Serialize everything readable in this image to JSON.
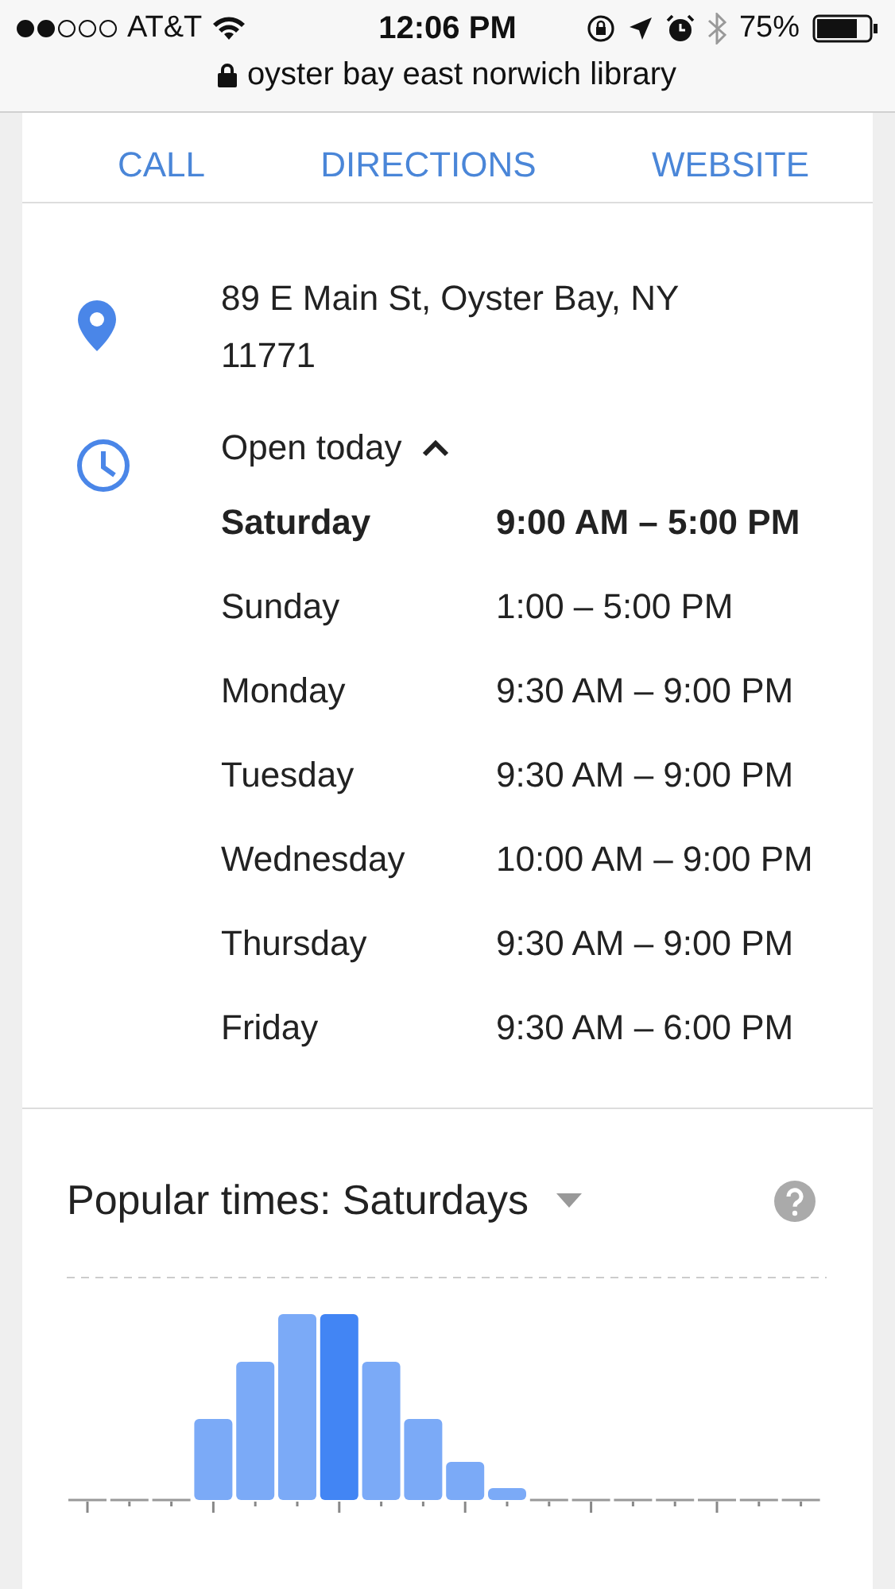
{
  "status_bar": {
    "carrier": "AT&T",
    "time": "12:06 PM",
    "battery": "75%"
  },
  "url_bar": {
    "title": "oyster bay east norwich library"
  },
  "actions": [
    {
      "label": "CALL"
    },
    {
      "label": "DIRECTIONS"
    },
    {
      "label": "WEBSITE"
    }
  ],
  "address": {
    "lines": [
      "89 E Main St, Oyster Bay, NY",
      "11771"
    ]
  },
  "hours": {
    "summary": "Open today",
    "expanded": true,
    "days": [
      {
        "day": "Saturday",
        "hours": "9:00 AM – 5:00 PM",
        "selected": true
      },
      {
        "day": "Sunday",
        "hours": "1:00 – 5:00 PM",
        "selected": false
      },
      {
        "day": "Monday",
        "hours": "9:30 AM – 9:00 PM",
        "selected": false
      },
      {
        "day": "Tuesday",
        "hours": "9:30 AM – 9:00 PM",
        "selected": false
      },
      {
        "day": "Wednesday",
        "hours": "10:00 AM – 9:00 PM",
        "selected": false
      },
      {
        "day": "Thursday",
        "hours": "9:30 AM – 9:00 PM",
        "selected": false
      },
      {
        "day": "Friday",
        "hours": "9:30 AM – 6:00 PM",
        "selected": false
      }
    ]
  },
  "popular_times": {
    "title": "Popular times: Saturdays"
  }
}
